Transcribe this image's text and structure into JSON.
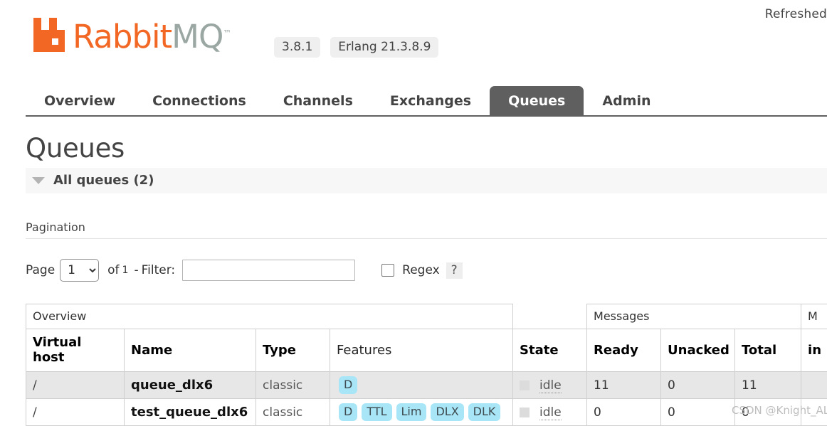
{
  "header": {
    "refreshed_label": "Refreshed",
    "logo_rabbit": "Rabbit",
    "logo_mq": "MQ",
    "logo_tm": "™",
    "version": "3.8.1",
    "erlang_version": "Erlang 21.3.8.9"
  },
  "nav": {
    "tabs": [
      {
        "label": "Overview",
        "active": false
      },
      {
        "label": "Connections",
        "active": false
      },
      {
        "label": "Channels",
        "active": false
      },
      {
        "label": "Exchanges",
        "active": false
      },
      {
        "label": "Queues",
        "active": true
      },
      {
        "label": "Admin",
        "active": false
      }
    ]
  },
  "page": {
    "title": "Queues",
    "section_title": "All queues (2)"
  },
  "pagination": {
    "label": "Pagination",
    "page_label": "Page",
    "page_value": "1",
    "page_options": [
      "1"
    ],
    "of_text": "of",
    "of_count": "1",
    "dash": "-",
    "filter_label": "Filter:",
    "filter_value": "",
    "filter_placeholder": "",
    "regex_label": "Regex",
    "regex_checked": false,
    "help_label": "?"
  },
  "table": {
    "groups": {
      "overview": "Overview",
      "messages": "Messages",
      "message_rates": "M"
    },
    "columns": {
      "vhost": "Virtual host",
      "name": "Name",
      "type": "Type",
      "features": "Features",
      "state": "State",
      "ready": "Ready",
      "unacked": "Unacked",
      "total": "Total",
      "incoming": "in"
    },
    "rows": [
      {
        "vhost": "/",
        "name": "queue_dlx6",
        "type": "classic",
        "features": [
          "D"
        ],
        "state": "idle",
        "ready": "11",
        "unacked": "0",
        "total": "11",
        "incoming": ""
      },
      {
        "vhost": "/",
        "name": "test_queue_dlx6",
        "type": "classic",
        "features": [
          "D",
          "TTL",
          "Lim",
          "DLX",
          "DLK"
        ],
        "state": "idle",
        "ready": "0",
        "unacked": "0",
        "total": "0",
        "incoming": ""
      }
    ]
  },
  "watermark": "CSDN @Knight_AL"
}
